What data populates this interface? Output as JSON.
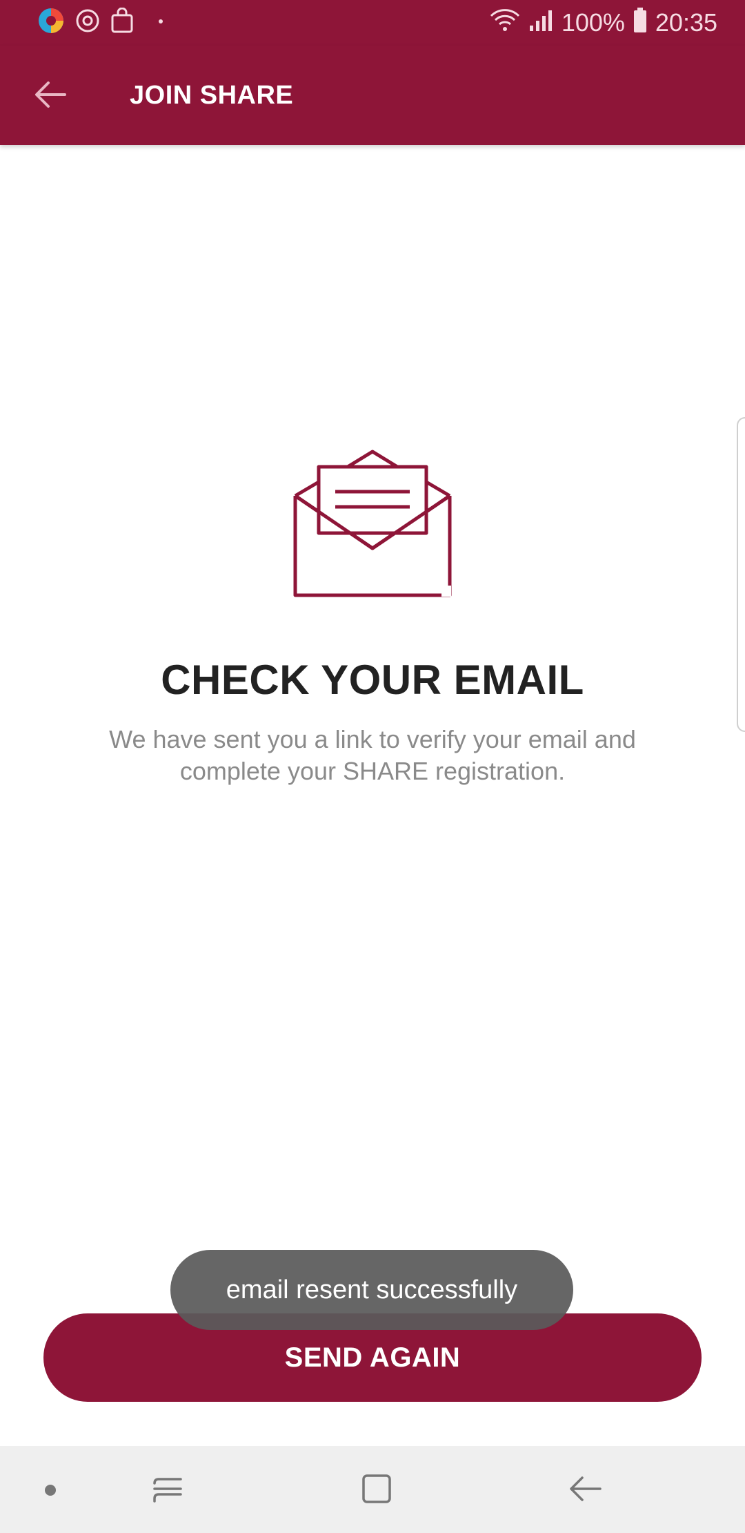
{
  "status_bar": {
    "battery_percent": "100%",
    "time": "20:35",
    "icons": [
      "colorful-app-icon",
      "sync-icon",
      "shopping-bag-icon",
      "dot-icon",
      "wifi-icon",
      "signal-icon",
      "battery-icon"
    ]
  },
  "app_bar": {
    "title": "JOIN SHARE",
    "back_icon": "arrow-left-icon"
  },
  "content": {
    "icon": "open-envelope-icon",
    "headline": "CHECK YOUR EMAIL",
    "description": "We have sent you a link to verify your email and complete your SHARE registration."
  },
  "actions": {
    "send_again_label": "SEND AGAIN"
  },
  "toast": {
    "message": "email resent successfully"
  },
  "nav_bar": {
    "icons": [
      "nav-dot-icon",
      "recent-apps-icon",
      "home-icon",
      "back-icon"
    ]
  },
  "colors": {
    "brand": "#8e1538",
    "headline": "#222222",
    "body_text": "#8a8a8a",
    "toast_bg": "#5a5a5a",
    "nav_bg": "#efefef"
  }
}
